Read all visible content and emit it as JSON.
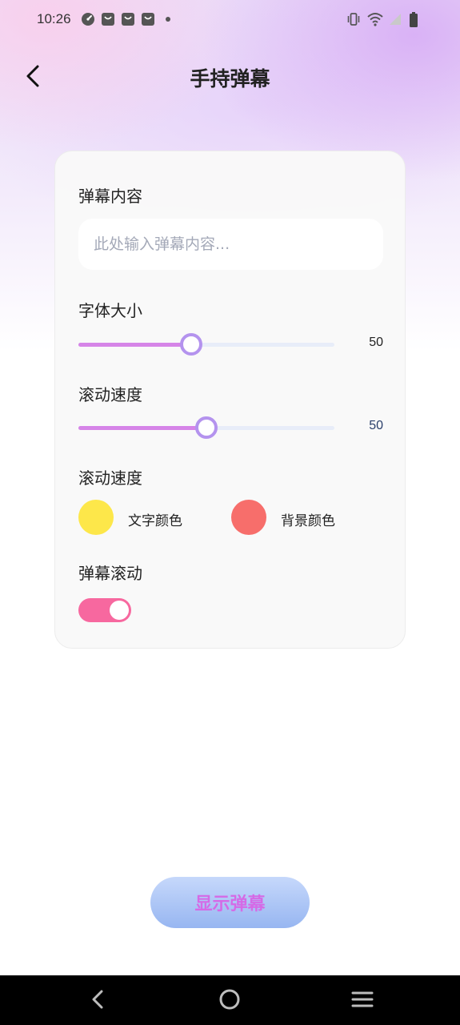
{
  "status_bar": {
    "time": "10:26",
    "left_icons": [
      "speedometer-icon",
      "bag-icon",
      "bag-icon",
      "bag-icon",
      "dot-icon"
    ],
    "right_icons": [
      "vibrate-icon",
      "wifi-icon",
      "signal-icon",
      "battery-icon"
    ]
  },
  "header": {
    "title": "手持弹幕",
    "back_icon": "chevron-left-icon"
  },
  "form": {
    "content_label": "弹幕内容",
    "content_placeholder": "此处输入弹幕内容...",
    "content_value": "",
    "font_size_label": "字体大小",
    "font_size_value": "50",
    "font_size_fraction": 0.44,
    "scroll_speed_label": "滚动速度",
    "scroll_speed_value": "50",
    "scroll_speed_fraction": 0.5,
    "color_section_label": "滚动速度",
    "text_color_label": "文字颜色",
    "text_color": "#fde74a",
    "bg_color_label": "背景颜色",
    "bg_color": "#f76e6b",
    "scroll_toggle_label": "弹幕滚动",
    "scroll_toggle_on": true
  },
  "primary_button": {
    "label": "显示弹幕"
  },
  "colors": {
    "accent_purple": "#d685e8",
    "thumb_border": "#b493ee",
    "toggle_on": "#f7689f",
    "button_text": "#d56ae6"
  },
  "nav_bar": {
    "icons": [
      "nav-back-icon",
      "nav-home-icon",
      "nav-menu-icon"
    ]
  }
}
